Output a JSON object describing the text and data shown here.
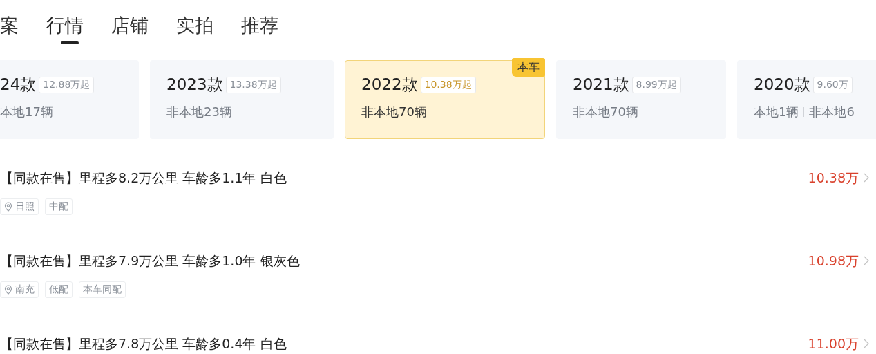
{
  "tabs": [
    {
      "label": "案",
      "selected": false
    },
    {
      "label": "行情",
      "selected": true
    },
    {
      "label": "店铺",
      "selected": false
    },
    {
      "label": "实拍",
      "selected": false
    },
    {
      "label": "推荐",
      "selected": false
    }
  ],
  "year_cards": [
    {
      "year": "24款",
      "price": "12.88万起",
      "counts": [
        "本地17辆"
      ],
      "selected": false
    },
    {
      "year": "2023款",
      "price": "13.38万起",
      "counts": [
        "非本地23辆"
      ],
      "selected": false
    },
    {
      "year": "2022款",
      "price": "10.38万起",
      "counts": [
        "非本地70辆"
      ],
      "selected": true,
      "badge": "本车"
    },
    {
      "year": "2021款",
      "price": "8.99万起",
      "counts": [
        "非本地70辆"
      ],
      "selected": false
    },
    {
      "year": "2020款",
      "price": "9.60万",
      "counts": [
        "本地1辆",
        "非本地6"
      ],
      "selected": false
    }
  ],
  "listings": [
    {
      "title": "【同款在售】里程多8.2万公里 车龄多1.1年 白色",
      "tags": [
        {
          "kind": "location",
          "text": "日照"
        },
        {
          "kind": "plain",
          "text": "中配"
        }
      ],
      "price": "10.38万"
    },
    {
      "title": "【同款在售】里程多7.9万公里 车龄多1.0年 银灰色",
      "tags": [
        {
          "kind": "location",
          "text": "南充"
        },
        {
          "kind": "plain",
          "text": "低配"
        },
        {
          "kind": "plain",
          "text": "本车同配"
        }
      ],
      "price": "10.98万"
    },
    {
      "title": "【同款在售】里程多7.8万公里 车龄多0.4年 白色",
      "price": "11.00万"
    }
  ]
}
